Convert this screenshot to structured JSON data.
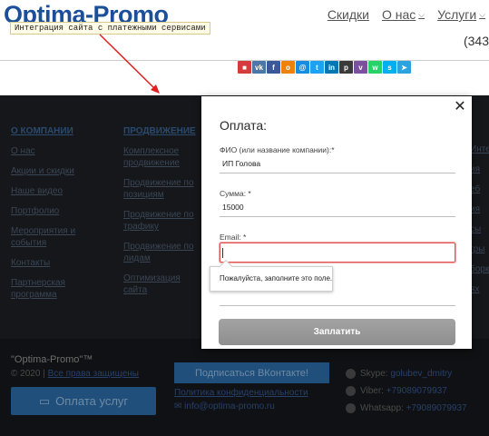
{
  "header": {
    "logo": "Optima-Promo",
    "annotation": "Интеграция сайта с платежными сервисами",
    "nav": [
      {
        "label": "Скидки",
        "has_chevron": false
      },
      {
        "label": "О нас",
        "has_chevron": true
      },
      {
        "label": "Услуги",
        "has_chevron": true
      }
    ],
    "phone_partial": "(343",
    "social_icons": [
      "bookmark-icon",
      "vk-icon",
      "facebook-icon",
      "odnoklassniki-icon",
      "mail-icon",
      "twitter-icon",
      "linkedin-icon",
      "pinterest-icon",
      "viber-icon",
      "whatsapp-icon",
      "skype-icon",
      "telegram-icon"
    ],
    "social_colors": [
      "#d43b3b",
      "#4a76a8",
      "#3b5998",
      "#ee8208",
      "#168de2",
      "#1da1f2",
      "#0077b5",
      "#3a3a3a",
      "#7b519d",
      "#25d366",
      "#00aff0",
      "#2aa3df"
    ]
  },
  "footer": {
    "col1": {
      "heading": "О КОМПАНИИ",
      "items": [
        "О нас",
        "Акции и скидки",
        "Наше видео",
        "Портфолио",
        "Мероприятия и события",
        "Контакты",
        "Партнерская программа"
      ]
    },
    "col2": {
      "heading": "ПРОДВИЖЕНИЕ",
      "items": [
        "Комплексное продвижение",
        "Продвижение по позициям",
        "Продвижение по трафику",
        "Продвижение по лидам",
        "Оптимизация сайта"
      ]
    },
    "col3": {
      "items": [
        "Интег",
        "ия",
        "еб",
        "ия",
        "сы",
        "гры",
        "борки",
        "ях"
      ]
    },
    "brand": "\"Optima-Promo\"™",
    "copyright_year": "© 2020 |",
    "copyright_link": "Все права защищены",
    "pay_button": "Оплата услуг",
    "vk_button": "Подписаться ВКонтакте!",
    "privacy": "Политика конфиденциальности",
    "email": "info@optima-promo.ru",
    "contacts": [
      {
        "label": "Skype:",
        "value": "golubev_dmitry"
      },
      {
        "label": "Viber:",
        "value": "+79089079937"
      },
      {
        "label": "Whatsapp:",
        "value": "+79089079937"
      }
    ]
  },
  "modal": {
    "title": "Оплата:",
    "fields": {
      "name": {
        "label": "ФИО (или название компании):*",
        "value": "ИП Голова"
      },
      "sum": {
        "label": "Сумма: *",
        "value": "15000"
      },
      "email": {
        "label": "Email: *",
        "value": ""
      }
    },
    "validation_hint": "Пожалуйста, заполните это поле.",
    "submit_label": "Заплатить",
    "close_glyph": "✕"
  }
}
